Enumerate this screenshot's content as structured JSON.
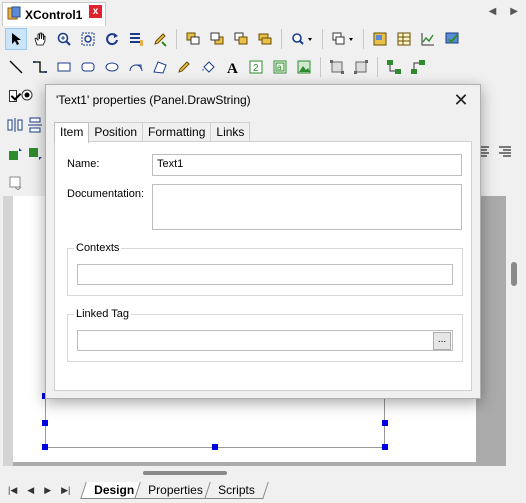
{
  "editor": {
    "tab_title": "XControl1",
    "close_glyph": "x",
    "nav_prev": "◀",
    "nav_next": "▶"
  },
  "toolbar1": {
    "icons": [
      "select-arrow-icon",
      "pan-hand-icon",
      "zoom-icon",
      "zoom-fit-icon",
      "refresh-icon",
      "properties-list-icon",
      "edit-pencil-icon",
      "bring-front-icon",
      "send-back-icon",
      "bring-forward-icon",
      "send-backward-icon",
      "search-dropdown-icon",
      "group-dropdown-icon",
      "panel-icon",
      "table-icon",
      "chart-icon",
      "settings-check-icon"
    ]
  },
  "toolbar2": {
    "icons": [
      "line-icon",
      "polyline-icon",
      "rectangle-icon",
      "rounded-rect-icon",
      "ellipse-icon",
      "arc-icon",
      "polygon-icon",
      "pencil-draw-icon",
      "fill-icon",
      "text-icon",
      "digit-display-icon",
      "label-icon",
      "image-icon",
      "align-icon",
      "align-alt-icon",
      "connect-icon",
      "connect-alt-icon"
    ]
  },
  "bottom_tabs": [
    {
      "label": "Design"
    },
    {
      "label": "Properties"
    },
    {
      "label": "Scripts"
    }
  ],
  "pager": [
    "|◀",
    "◀",
    "▶",
    "▶|"
  ],
  "dialog": {
    "title": "'Text1' properties (Panel.DrawString)",
    "close_glyph": "✕",
    "tabs": [
      {
        "label": "Item"
      },
      {
        "label": "Position"
      },
      {
        "label": "Formatting"
      },
      {
        "label": "Links"
      }
    ],
    "name_label": "Name:",
    "name_value": "Text1",
    "documentation_label": "Documentation:",
    "documentation_value": "",
    "contexts_label": "Contexts",
    "contexts_value": "",
    "linked_tag_label": "Linked Tag",
    "linked_tag_value": "",
    "browse_label": "..."
  }
}
